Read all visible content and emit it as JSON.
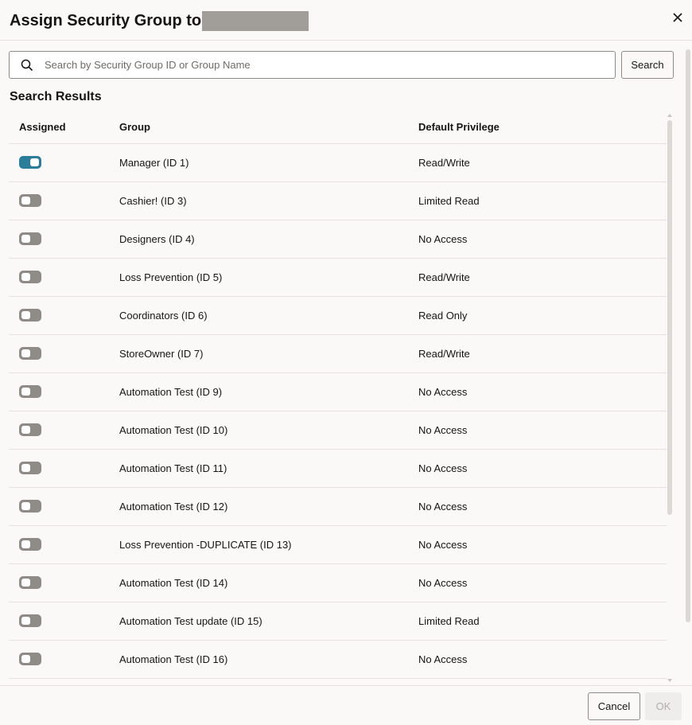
{
  "dialog": {
    "title": "Assign Security Group to"
  },
  "search": {
    "placeholder": "Search by Security Group ID or Group Name",
    "value": "",
    "button_label": "Search"
  },
  "results": {
    "heading": "Search Results",
    "columns": {
      "assigned": "Assigned",
      "group": "Group",
      "privilege": "Default Privilege"
    },
    "rows": [
      {
        "assigned": true,
        "group": "Manager (ID 1)",
        "privilege": "Read/Write"
      },
      {
        "assigned": false,
        "group": "Cashier! (ID 3)",
        "privilege": "Limited Read"
      },
      {
        "assigned": false,
        "group": "Designers (ID 4)",
        "privilege": "No Access"
      },
      {
        "assigned": false,
        "group": "Loss Prevention (ID 5)",
        "privilege": "Read/Write"
      },
      {
        "assigned": false,
        "group": "Coordinators (ID 6)",
        "privilege": "Read Only"
      },
      {
        "assigned": false,
        "group": "StoreOwner (ID 7)",
        "privilege": "Read/Write"
      },
      {
        "assigned": false,
        "group": "Automation Test (ID 9)",
        "privilege": "No Access"
      },
      {
        "assigned": false,
        "group": "Automation Test (ID 10)",
        "privilege": "No Access"
      },
      {
        "assigned": false,
        "group": "Automation Test (ID 11)",
        "privilege": "No Access"
      },
      {
        "assigned": false,
        "group": "Automation Test (ID 12)",
        "privilege": "No Access"
      },
      {
        "assigned": false,
        "group": "Loss Prevention -DUPLICATE (ID 13)",
        "privilege": "No Access"
      },
      {
        "assigned": false,
        "group": "Automation Test (ID 14)",
        "privilege": "No Access"
      },
      {
        "assigned": false,
        "group": "Automation Test update (ID 15)",
        "privilege": "Limited Read"
      },
      {
        "assigned": false,
        "group": "Automation Test (ID 16)",
        "privilege": "No Access"
      },
      {
        "assigned": false,
        "group": "",
        "privilege": ""
      }
    ]
  },
  "footer": {
    "cancel_label": "Cancel",
    "ok_label": "OK"
  },
  "icons": {
    "close": "close-icon",
    "search": "search-icon"
  },
  "colors": {
    "toggle_on": "#2b7d9a",
    "toggle_off": "#8f8b87",
    "redaction": "#a19d99"
  }
}
